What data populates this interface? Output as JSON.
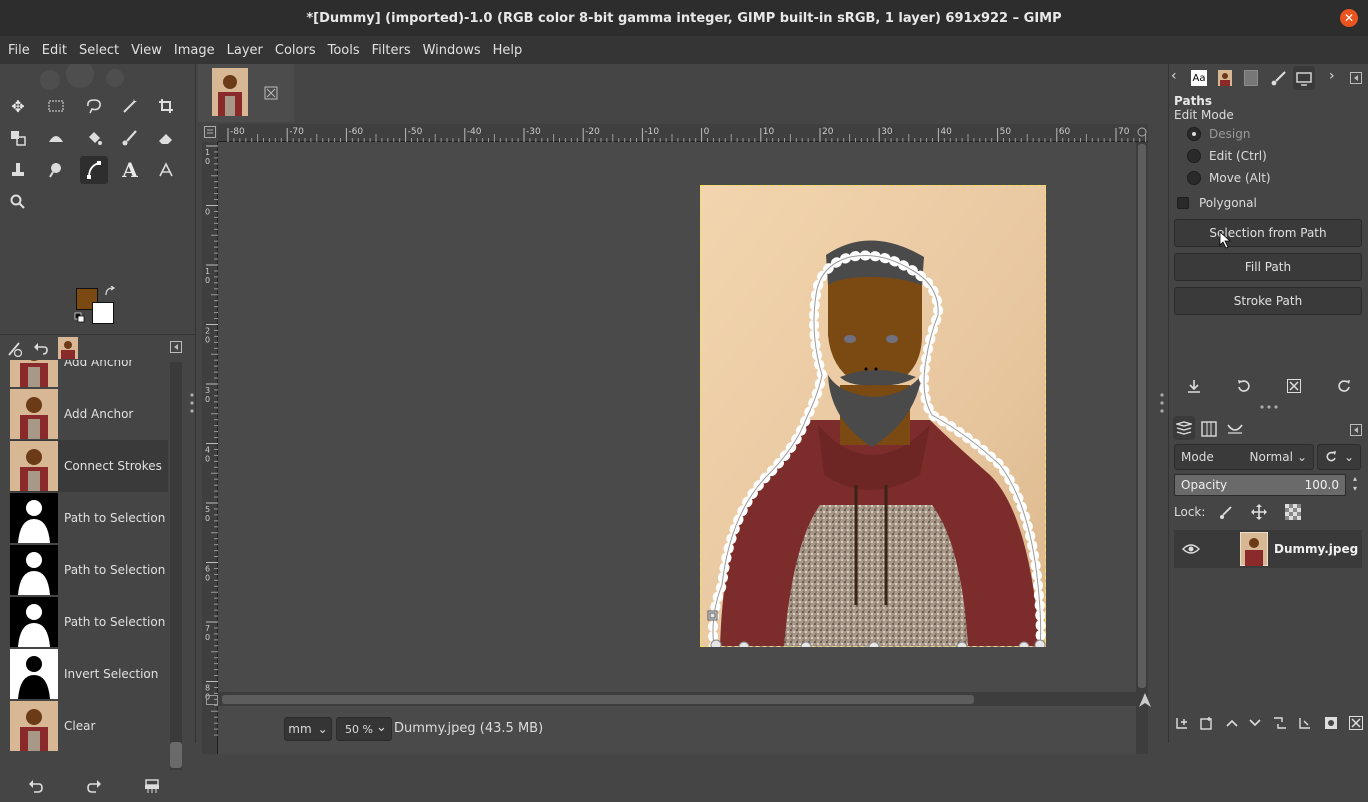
{
  "window": {
    "title": "*[Dummy] (imported)-1.0 (RGB color 8-bit gamma integer, GIMP built-in sRGB, 1 layer) 691x922 – GIMP",
    "close_glyph": "✕"
  },
  "menubar": [
    "File",
    "Edit",
    "Select",
    "View",
    "Image",
    "Layer",
    "Colors",
    "Tools",
    "Filters",
    "Windows",
    "Help"
  ],
  "colors": {
    "foreground": "#7a4a12",
    "background": "#ffffff",
    "accent": "#e95420"
  },
  "history": {
    "items": [
      {
        "label": "Add Anchor",
        "thumb": "photo"
      },
      {
        "label": "Add Anchor",
        "thumb": "photo"
      },
      {
        "label": "Connect Strokes",
        "thumb": "photo",
        "selected": true
      },
      {
        "label": "Path to Selection",
        "thumb": "mask"
      },
      {
        "label": "Path to Selection",
        "thumb": "mask"
      },
      {
        "label": "Path to Selection",
        "thumb": "mask"
      },
      {
        "label": "Invert Selection",
        "thumb": "mask-inverted"
      },
      {
        "label": "Clear",
        "thumb": "photo"
      }
    ]
  },
  "ruler": {
    "h_labels": [
      "-80",
      "-70",
      "-60",
      "-50",
      "-40",
      "-30",
      "-20",
      "-10",
      "0",
      "10",
      "20",
      "30",
      "40",
      "50",
      "60",
      "70"
    ],
    "v_labels": [
      "1 0",
      "0",
      "1 0",
      "2 0",
      "3 0",
      "4 0",
      "5 0",
      "6 0",
      "7 0",
      "8 0"
    ]
  },
  "status": {
    "unit": "mm",
    "zoom": "50 %",
    "file_info": "Dummy.jpeg (43.5 MB)"
  },
  "paths_panel": {
    "title": "Paths",
    "edit_mode_label": "Edit Mode",
    "modes": [
      "Design",
      "Edit (Ctrl)",
      "Move (Alt)"
    ],
    "polygonal_label": "Polygonal",
    "buttons": [
      "Selection from Path",
      "Fill Path",
      "Stroke Path"
    ]
  },
  "layers_panel": {
    "mode_label": "Mode",
    "mode_value": "Normal",
    "opacity_label": "Opacity",
    "opacity_value": "100.0",
    "lock_label": "Lock:",
    "layer_name": "Dummy.jpeg"
  }
}
